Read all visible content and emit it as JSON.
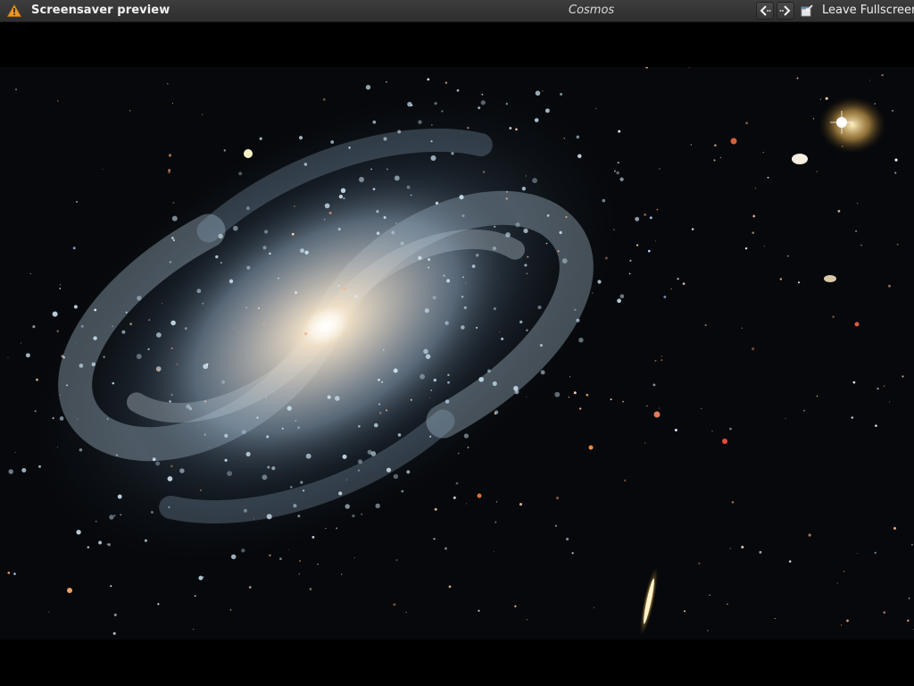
{
  "window": {
    "title": "Screensaver preview",
    "subtitle": "Cosmos",
    "icon": "warning-icon"
  },
  "toolbar": {
    "prev_icon": "back-arrow-icon",
    "next_icon": "forward-arrow-icon",
    "leave_fullscreen_icon": "leave-fullscreen-icon",
    "leave_fullscreen_label": "Leave Fullscreen"
  },
  "colors": {
    "bar_background": "#333333",
    "warning": "#f0a030",
    "space": "#07090c",
    "galaxy_core": "#fff4d8",
    "galaxy_arm": "#bcd3e8"
  }
}
